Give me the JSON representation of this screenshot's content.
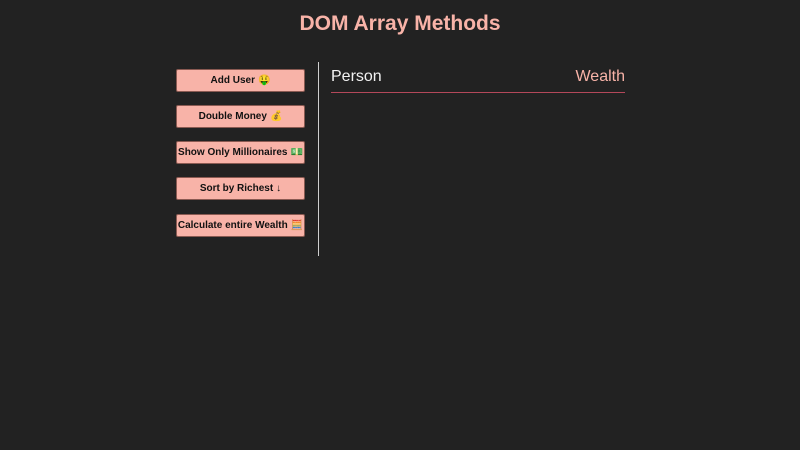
{
  "header": {
    "title": "DOM Array Methods"
  },
  "sidebar": {
    "buttons": [
      {
        "label": "Add User",
        "icon": "🤑",
        "icon_name": "money-face-icon"
      },
      {
        "label": "Double Money",
        "icon": "💰",
        "icon_name": "money-bag-icon"
      },
      {
        "label": "Show Only Millionaires",
        "icon": "💵",
        "icon_name": "banknote-icon"
      },
      {
        "label": "Sort by Richest",
        "icon": "↓",
        "icon_name": "arrow-down-icon"
      },
      {
        "label": "Calculate entire Wealth",
        "icon": "🧮",
        "icon_name": "abacus-icon"
      }
    ]
  },
  "table": {
    "columns": {
      "person": "Person",
      "wealth": "Wealth"
    },
    "rows": []
  },
  "colors": {
    "background": "#222222",
    "accent": "#f8b3a8",
    "divider": "#cfcfcf",
    "header_underline": "#b4485a"
  }
}
